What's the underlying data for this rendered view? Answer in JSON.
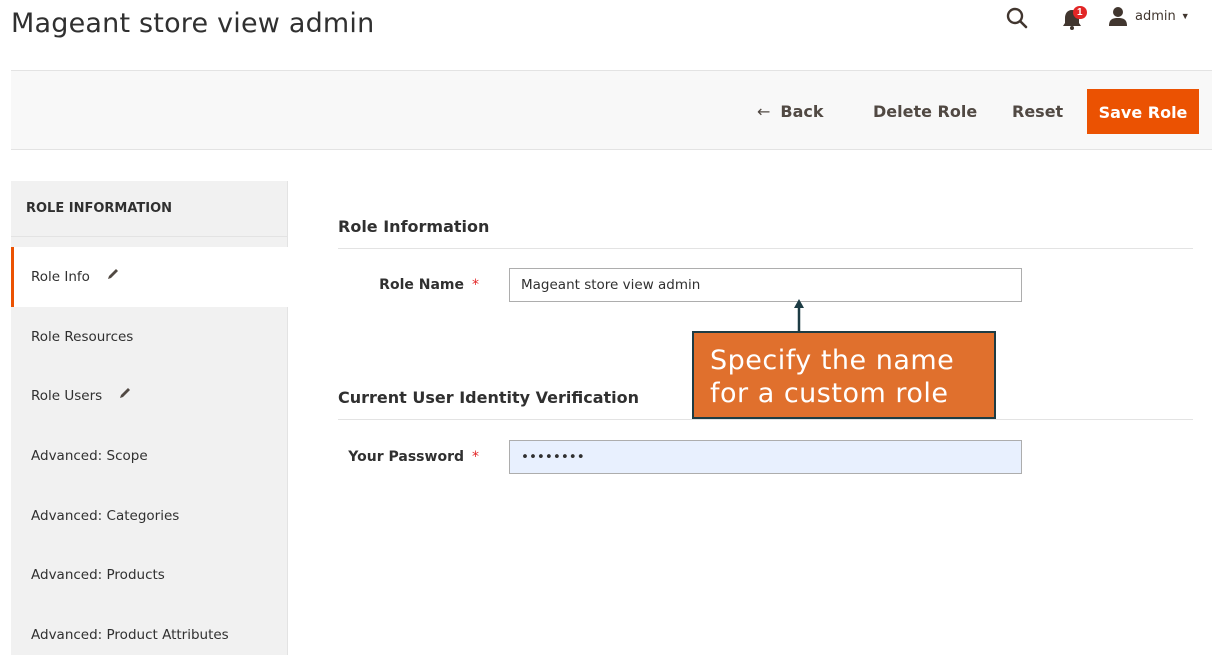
{
  "header": {
    "page_title": "Mageant store view admin",
    "notification_count": "1",
    "user_name": "admin",
    "icons": {
      "search": "search-icon",
      "bell": "bell-icon",
      "user": "user-icon",
      "caret": "chevron-down-icon"
    }
  },
  "actions": {
    "back_label": "Back",
    "delete_label": "Delete Role",
    "reset_label": "Reset",
    "save_label": "Save Role"
  },
  "sidebar": {
    "title": "ROLE INFORMATION",
    "tabs": [
      {
        "label": "Role Info",
        "edited": true,
        "active": true
      },
      {
        "label": "Role Resources",
        "edited": false,
        "active": false
      },
      {
        "label": "Role Users",
        "edited": true,
        "active": false
      },
      {
        "label": "Advanced: Scope",
        "edited": false,
        "active": false
      },
      {
        "label": "Advanced: Categories",
        "edited": false,
        "active": false
      },
      {
        "label": "Advanced: Products",
        "edited": false,
        "active": false
      },
      {
        "label": "Advanced: Product Attributes",
        "edited": false,
        "active": false
      }
    ]
  },
  "form": {
    "role_section_title": "Role Information",
    "role_name_label": "Role Name",
    "role_name_value": "Mageant store view admin",
    "verification_section_title": "Current User Identity Verification",
    "password_label": "Your Password",
    "password_value": "••••••••",
    "required_mark": "*"
  },
  "callout": {
    "line1": "Specify the name",
    "line2": "for a custom role"
  },
  "colors": {
    "accent": "#eb5202",
    "callout_bg": "#e0702d",
    "callout_border": "#1d3c44",
    "required": "#e22626"
  }
}
